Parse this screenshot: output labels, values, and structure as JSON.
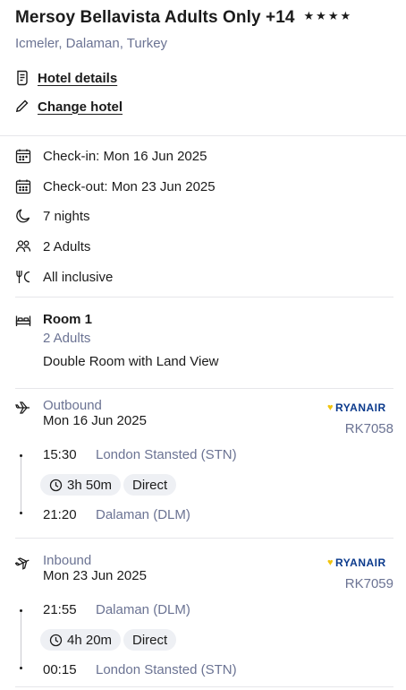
{
  "hotel": {
    "name": "Mersoy Bellavista Adults Only +14",
    "stars": "★★★★",
    "location": "Icmeler, Dalaman, Turkey"
  },
  "links": {
    "details": "Hotel details",
    "change": "Change hotel"
  },
  "stay": {
    "checkin": "Check-in: Mon 16 Jun 2025",
    "checkout": "Check-out: Mon 23 Jun 2025",
    "nights": "7 nights",
    "guests": "2 Adults",
    "board": "All inclusive"
  },
  "room": {
    "title": "Room 1",
    "guests": "2 Adults",
    "type": "Double Room with Land View"
  },
  "outbound": {
    "label": "Outbound",
    "date": "Mon 16 Jun 2025",
    "airline": "RYANAIR",
    "flight_no": "RK7058",
    "dep_time": "15:30",
    "dep_airport": "London Stansted (STN)",
    "duration": "3h 50m",
    "stops": "Direct",
    "arr_time": "21:20",
    "arr_airport": "Dalaman (DLM)"
  },
  "inbound": {
    "label": "Inbound",
    "date": "Mon 23 Jun 2025",
    "airline": "RYANAIR",
    "flight_no": "RK7059",
    "dep_time": "21:55",
    "dep_airport": "Dalaman (DLM)",
    "duration": "4h 20m",
    "stops": "Direct",
    "arr_time": "00:15",
    "arr_airport": "London Stansted (STN)"
  }
}
